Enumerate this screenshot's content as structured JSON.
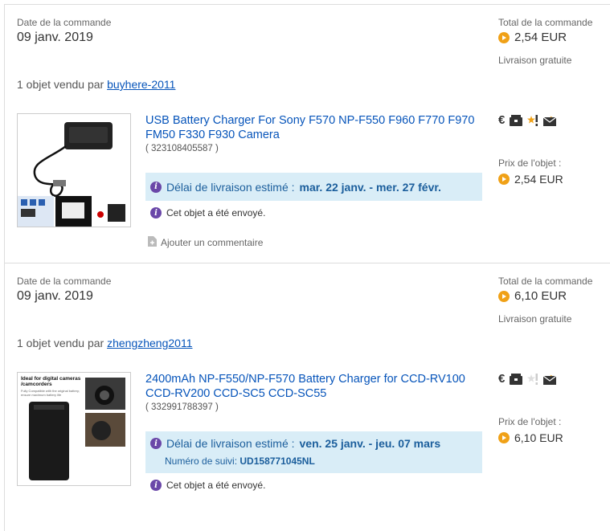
{
  "orders": [
    {
      "date_label": "Date de la commande",
      "date": "09 janv. 2019",
      "total_label": "Total de la commande",
      "total": "2,54 EUR",
      "shipping": "Livraison gratuite",
      "seller_prefix": "1 objet vendu par",
      "seller": "buyhere-2011",
      "item_title": "USB Battery Charger For Sony F570 NP-F550 F960 F770 F970 FM50 F330 F930 Camera",
      "item_id": "( 323108405587 )",
      "delivery_prefix": "Délai de livraison estimé :",
      "delivery_dates": "mar. 22 janv. - mer. 27 févr.",
      "sent": "Cet objet a été envoyé.",
      "comment": "Ajouter un commentaire",
      "item_price_label": "Prix de l'objet :",
      "item_price": "2,54 EUR",
      "euro_symbol": "€"
    },
    {
      "date_label": "Date de la commande",
      "date": "09 janv. 2019",
      "total_label": "Total de la commande",
      "total": "6,10 EUR",
      "shipping": "Livraison gratuite",
      "seller_prefix": "1 objet vendu par",
      "seller": "zhengzheng2011",
      "item_title": "2400mAh NP-F550/NP-F570 Battery Charger for CCD-RV100 CCD-RV200 CCD-SC5 CCD-SC55",
      "item_id": "( 332991788397 )",
      "delivery_prefix": "Délai de livraison estimé :",
      "delivery_dates": "ven. 25 janv. - jeu. 07 mars",
      "tracking_label": "Numéro de suivi:",
      "tracking": "UD158771045NL",
      "sent": "Cet objet a été envoyé.",
      "item_price_label": "Prix de l'objet :",
      "item_price": "6,10 EUR",
      "euro_symbol": "€",
      "thumb_caption_1": "Ideal for digital cameras /camcorders",
      "thumb_caption_2": "Fully Compatible with the original battery; ensure maximum battery life"
    }
  ],
  "colors": {
    "link": "#0654ba",
    "info_bg": "#d9edf7",
    "coin": "#f0a117",
    "info_icon": "#6a47a8"
  }
}
